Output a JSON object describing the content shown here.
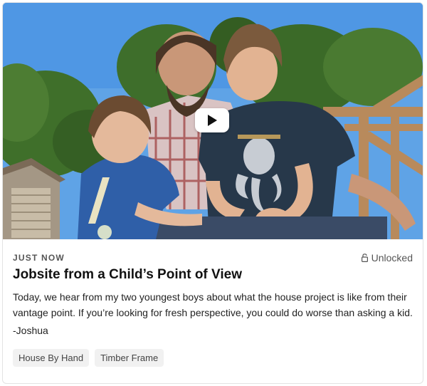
{
  "post": {
    "timestamp": "JUST NOW",
    "access_status": "Unlocked",
    "title": "Jobsite from a Child’s Point of View",
    "description": "Today, we hear from my two youngest boys about what the house project is like from their vantage point. If you’re looking for fresh perspective, you could do worse than asking a kid.",
    "signature": "-Joshua",
    "tags": [
      "House By Hand",
      "Timber Frame"
    ]
  },
  "video": {
    "play_icon": "play-icon",
    "has_play_button": true
  },
  "icons": {
    "lock": "unlock-icon"
  },
  "colors": {
    "sky": "#6faee8",
    "tag_bg": "#f1f1f1",
    "muted_text": "#555555"
  }
}
